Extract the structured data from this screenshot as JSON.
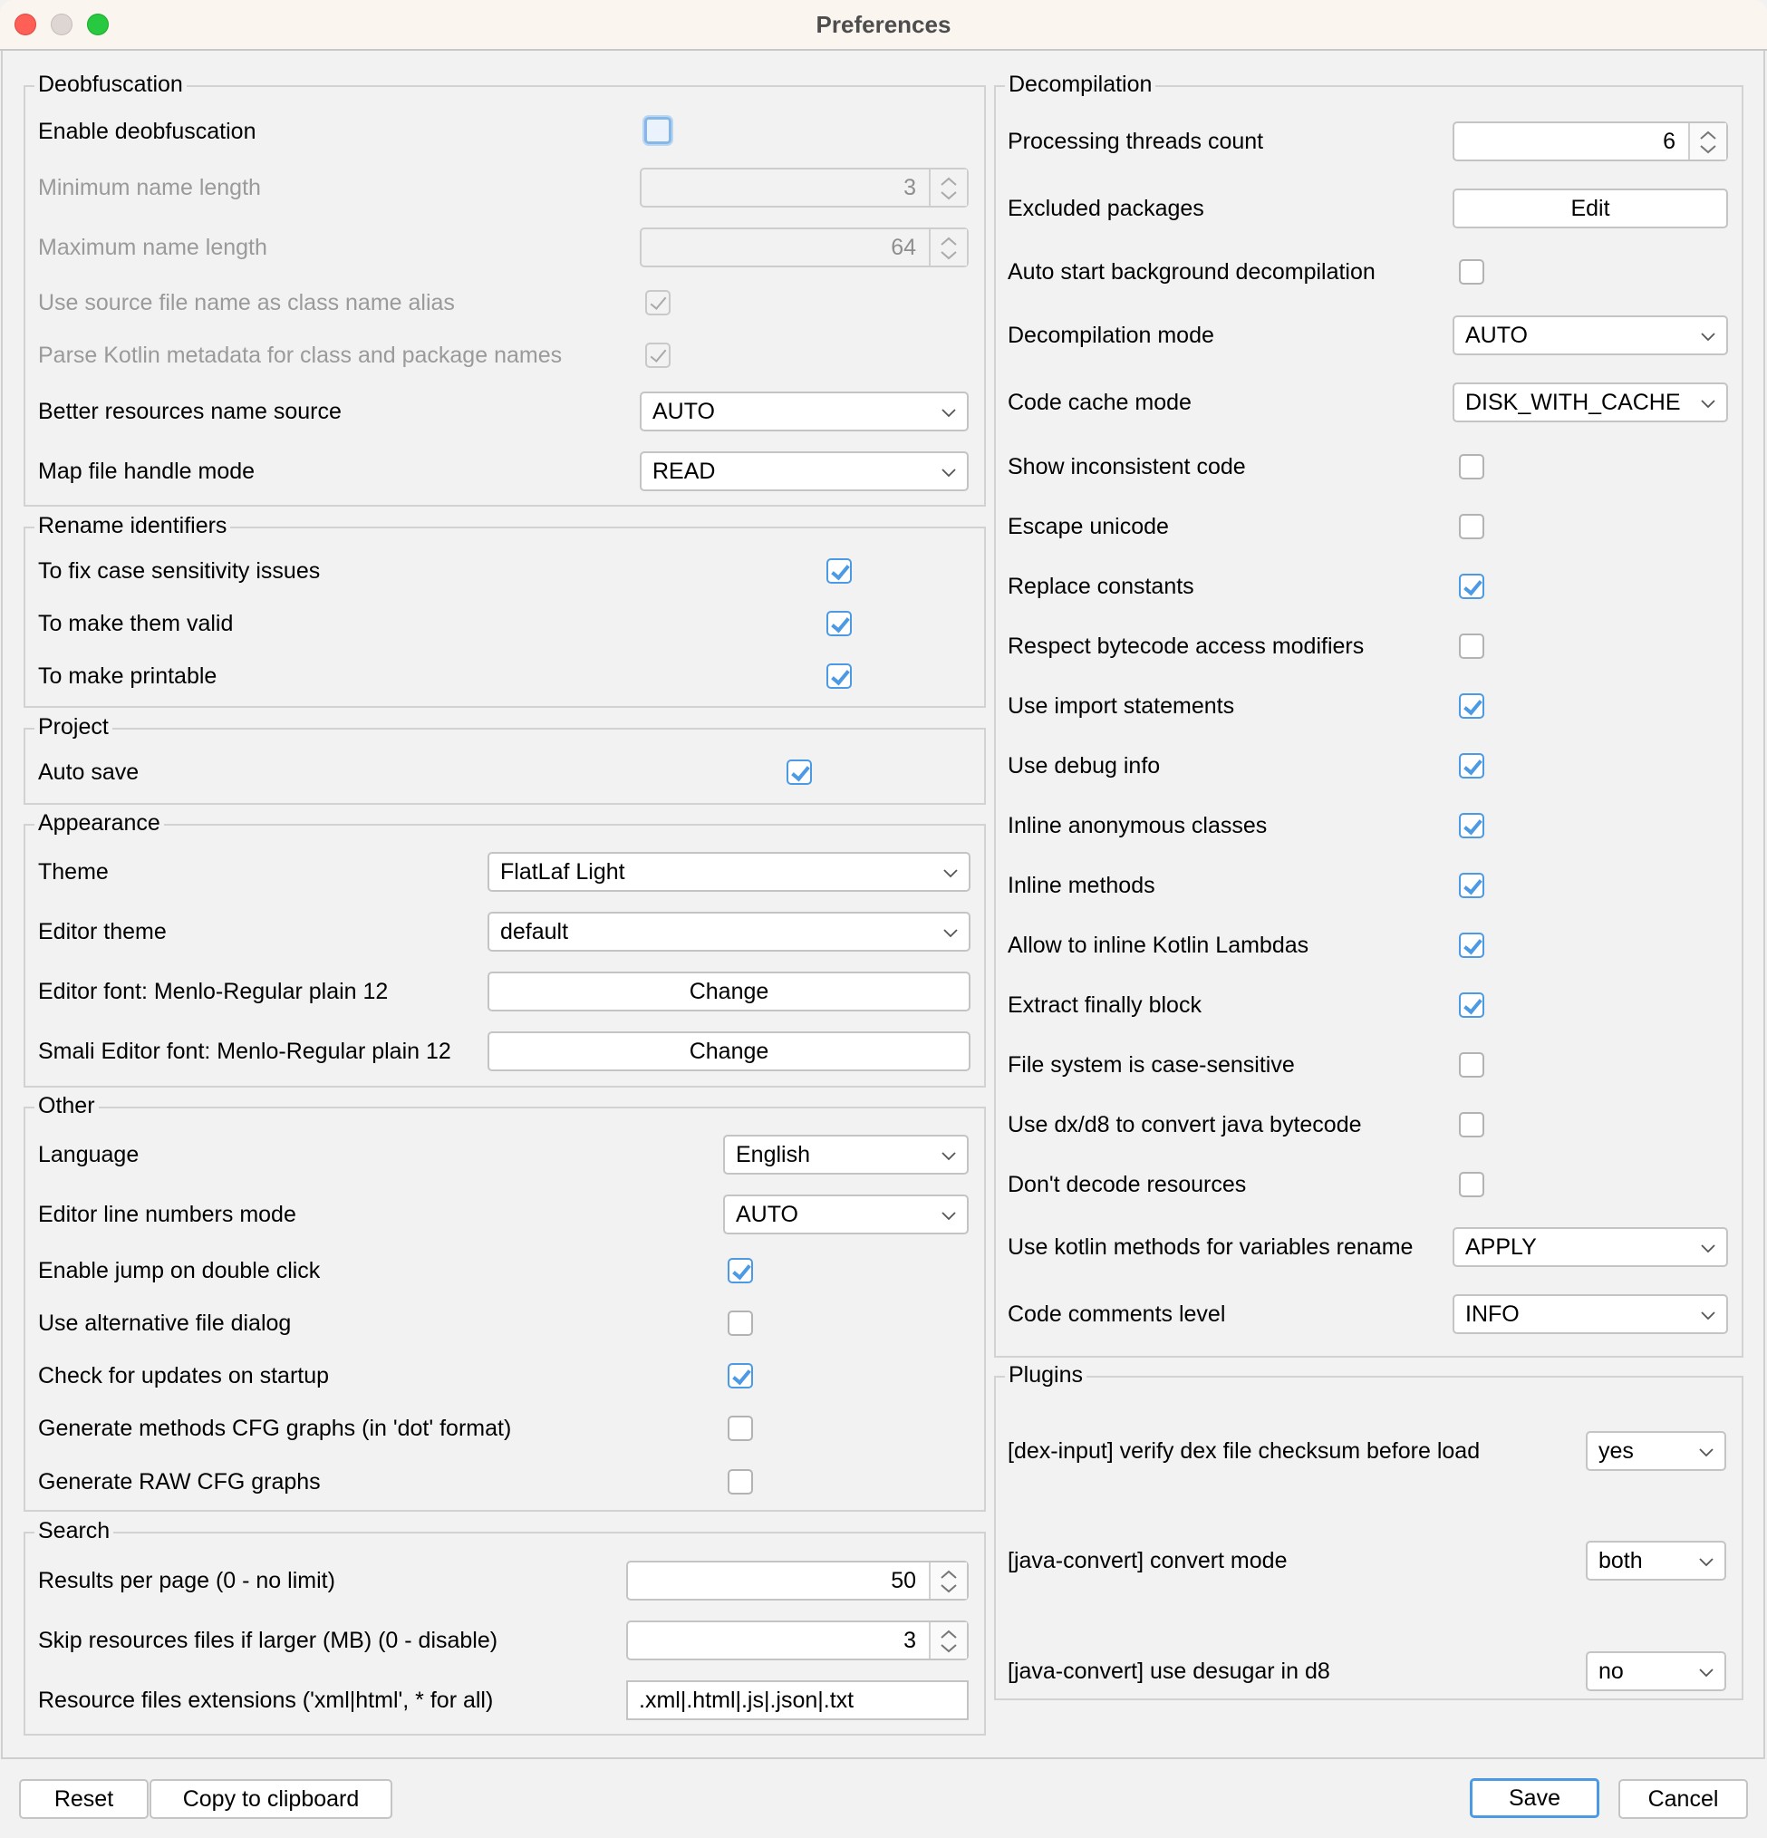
{
  "window": {
    "title": "Preferences"
  },
  "deobfuscation": {
    "title": "Deobfuscation",
    "enable_label": "Enable deobfuscation",
    "enable_checked": false,
    "min_len_label": "Minimum name length",
    "min_len_value": "3",
    "max_len_label": "Maximum name length",
    "max_len_value": "64",
    "use_source_label": "Use source file name as class name alias",
    "use_source_checked": true,
    "parse_kotlin_label": "Parse Kotlin metadata for class and package names",
    "parse_kotlin_checked": true,
    "res_name_label": "Better resources name source",
    "res_name_value": "AUTO",
    "map_file_label": "Map file handle mode",
    "map_file_value": "READ"
  },
  "rename": {
    "title": "Rename identifiers",
    "items": [
      {
        "label": "To fix case sensitivity issues",
        "checked": true
      },
      {
        "label": "To make them valid",
        "checked": true
      },
      {
        "label": "To make printable",
        "checked": true
      }
    ]
  },
  "project": {
    "title": "Project",
    "autosave_label": "Auto save",
    "autosave_checked": true
  },
  "appearance": {
    "title": "Appearance",
    "theme_label": "Theme",
    "theme_value": "FlatLaf Light",
    "editor_theme_label": "Editor theme",
    "editor_theme_value": "default",
    "editor_font_label": "Editor font: Menlo-Regular plain 12",
    "editor_font_button": "Change",
    "smali_font_label": "Smali Editor font: Menlo-Regular plain 12",
    "smali_font_button": "Change"
  },
  "other": {
    "title": "Other",
    "language_label": "Language",
    "language_value": "English",
    "line_numbers_label": "Editor line numbers mode",
    "line_numbers_value": "AUTO",
    "items": [
      {
        "label": "Enable jump on double click",
        "checked": true
      },
      {
        "label": "Use alternative file dialog",
        "checked": false
      },
      {
        "label": "Check for updates on startup",
        "checked": true
      },
      {
        "label": "Generate methods CFG graphs (in 'dot' format)",
        "checked": false
      },
      {
        "label": "Generate RAW CFG graphs",
        "checked": false
      }
    ]
  },
  "search": {
    "title": "Search",
    "results_label": "Results per page (0 - no limit)",
    "results_value": "50",
    "skip_label": "Skip resources files if larger (MB) (0 - disable)",
    "skip_value": "3",
    "ext_label": "Resource files extensions ('xml|html', * for all)",
    "ext_value": ".xml|.html|.js|.json|.txt"
  },
  "decompilation": {
    "title": "Decompilation",
    "threads_label": "Processing threads count",
    "threads_value": "6",
    "excluded_label": "Excluded packages",
    "excluded_button": "Edit",
    "auto_start_label": "Auto start background decompilation",
    "auto_start_checked": false,
    "mode_label": "Decompilation mode",
    "mode_value": "AUTO",
    "cache_label": "Code cache mode",
    "cache_value": "DISK_WITH_CACHE",
    "items": [
      {
        "label": "Show inconsistent code",
        "checked": false
      },
      {
        "label": "Escape unicode",
        "checked": false
      },
      {
        "label": "Replace constants",
        "checked": true
      },
      {
        "label": "Respect bytecode access modifiers",
        "checked": false
      },
      {
        "label": "Use import statements",
        "checked": true
      },
      {
        "label": "Use debug info",
        "checked": true
      },
      {
        "label": "Inline anonymous classes",
        "checked": true
      },
      {
        "label": "Inline methods",
        "checked": true
      },
      {
        "label": "Allow to inline Kotlin Lambdas",
        "checked": true
      },
      {
        "label": "Extract finally block",
        "checked": true
      },
      {
        "label": "File system is case-sensitive",
        "checked": false
      },
      {
        "label": "Use dx/d8 to convert java bytecode",
        "checked": false
      },
      {
        "label": "Don't decode resources",
        "checked": false
      }
    ],
    "kotlin_rename_label": "Use kotlin methods for variables rename",
    "kotlin_rename_value": "APPLY",
    "comments_label": "Code comments level",
    "comments_value": "INFO"
  },
  "plugins": {
    "title": "Plugins",
    "items": [
      {
        "label": "[dex-input]  verify dex file checksum before load",
        "value": "yes"
      },
      {
        "label": "[java-convert]  convert mode",
        "value": "both"
      },
      {
        "label": "[java-convert]  use desugar in d8",
        "value": "no"
      }
    ]
  },
  "footer": {
    "reset": "Reset",
    "copy": "Copy to clipboard",
    "save": "Save",
    "cancel": "Cancel"
  },
  "colors": {
    "accent": "#4c9ae4",
    "titlebar": "#fbf5f0",
    "background": "#f2f2f2"
  }
}
